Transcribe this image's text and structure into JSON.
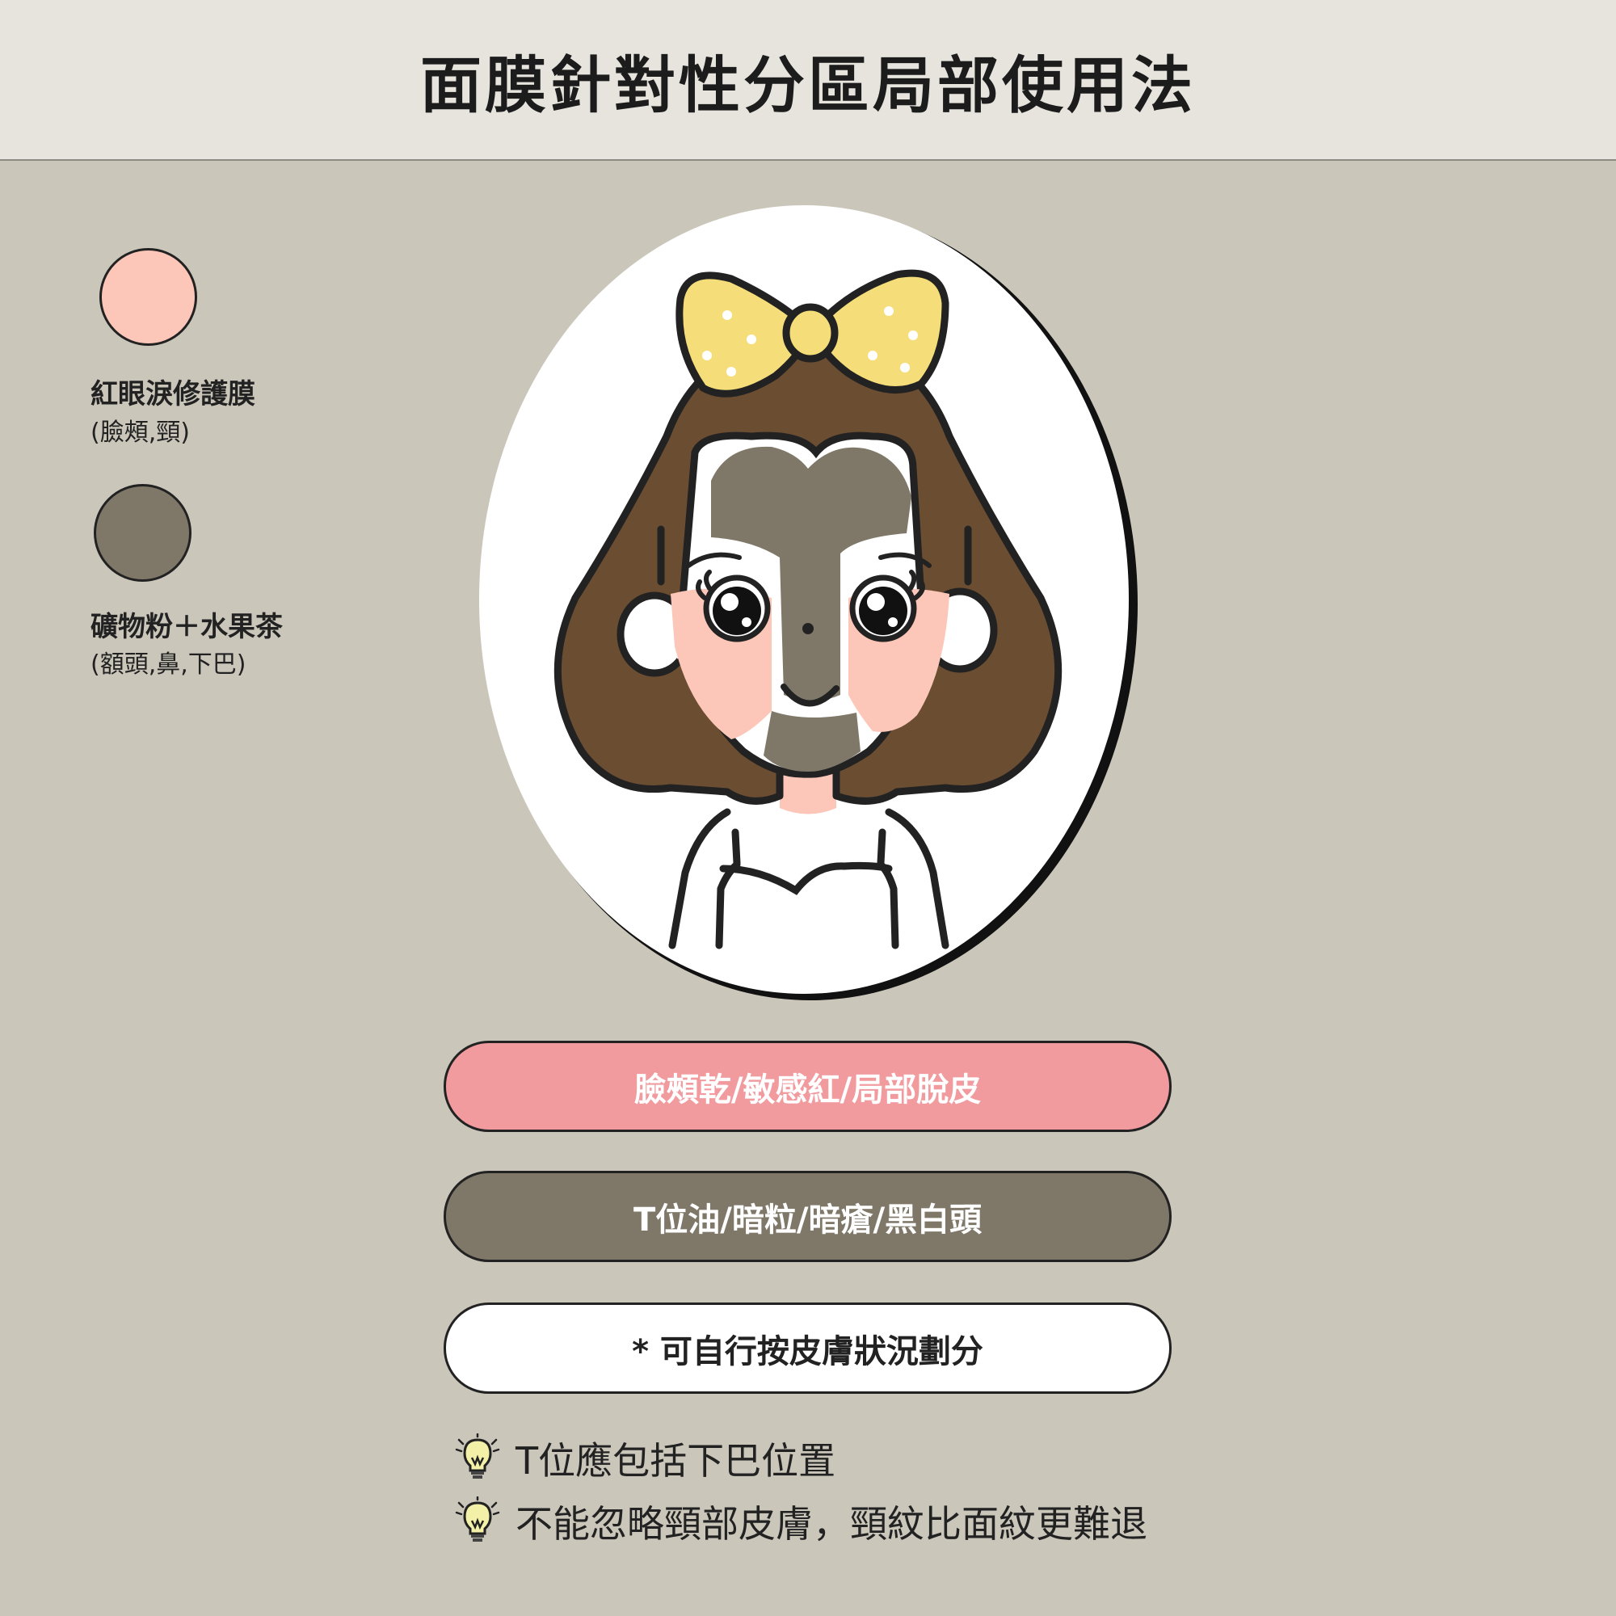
{
  "title": "面膜針對性分區局部使用法",
  "colors": {
    "background": "#cbc6ba",
    "header": "#e6e4dd",
    "pink_mask": "#fcc7b8",
    "gray_mask": "#7f7869",
    "pill_pink": "#f19b9f",
    "hair": "#6b4d32",
    "bow": "#f5de7a"
  },
  "legend": [
    {
      "name": "紅眼淚修護膜",
      "area": "(臉頰,頸)",
      "color": "#fcc7b8"
    },
    {
      "name": "礦物粉＋水果茶",
      "area": "(額頭,鼻,下巴)",
      "color": "#7f7869"
    }
  ],
  "pills": {
    "pink": "臉頰乾/敏感紅/局部脫皮",
    "gray": "T位油/暗粒/暗瘡/黑白頭",
    "note": "* 可自行按皮膚狀況劃分"
  },
  "tips": [
    {
      "icon": "lightbulb-icon",
      "text": "T位應包括下巴位置"
    },
    {
      "icon": "lightbulb-icon",
      "text": "不能忽略頸部皮膚，頸紋比面紋更難退"
    }
  ]
}
